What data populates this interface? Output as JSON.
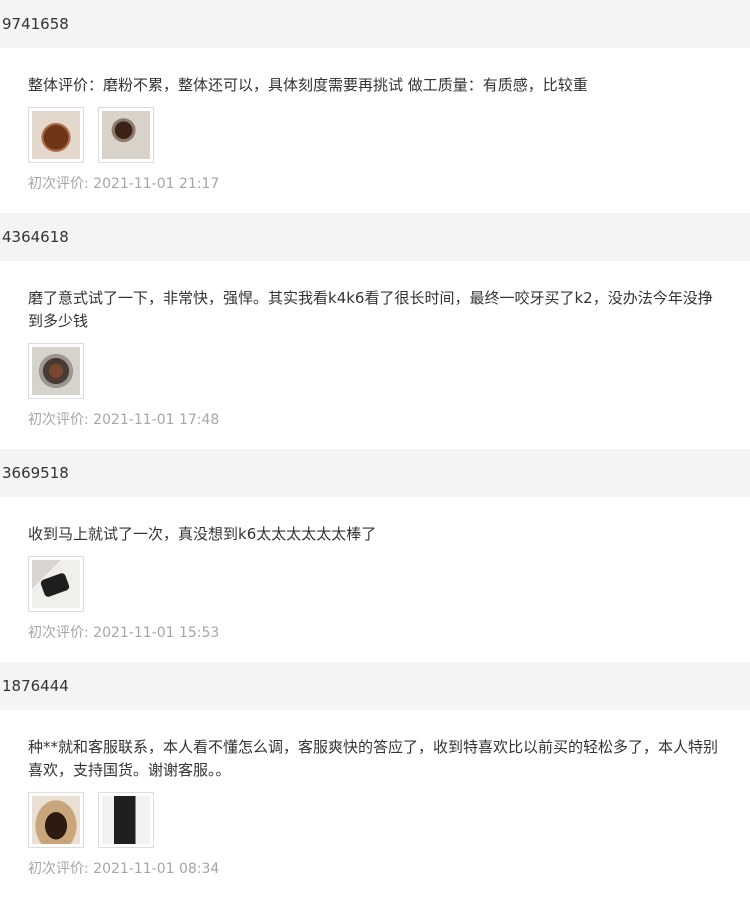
{
  "reviews": [
    {
      "user": "9741658",
      "comment": "整体评价：磨粉不累，整体还可以，具体刻度需要再挑试 做工质量：有质感，比较重",
      "images": [
        "coffee-grounds-photo",
        "coffee-grounds-photo"
      ],
      "timestamp": "初次评价: 2021-11-01 21:17"
    },
    {
      "user": "4364618",
      "comment": "磨了意式试了一下，非常快，强悍。其实我看k4k6看了很长时间，最终一咬牙买了k2，没办法今年没挣到多少钱",
      "images": [
        "grinder-cup-photo"
      ],
      "timestamp": "初次评价: 2021-11-01 17:48"
    },
    {
      "user": "3669518",
      "comment": "收到马上就试了一次，真没想到k6太太太太太太棒了",
      "images": [
        "grinder-photo"
      ],
      "timestamp": "初次评价: 2021-11-01 15:53"
    },
    {
      "user": "1876444",
      "comment": "种**就和客服联系，本人看不懂怎么调，客服爽快的答应了，收到特喜欢比以前买的轻松多了，本人特别喜欢，支持国货。谢谢客服。。",
      "images": [
        "coffee-grounds-photo",
        "grinder-photo"
      ],
      "timestamp": "初次评价: 2021-11-01 08:34"
    }
  ]
}
